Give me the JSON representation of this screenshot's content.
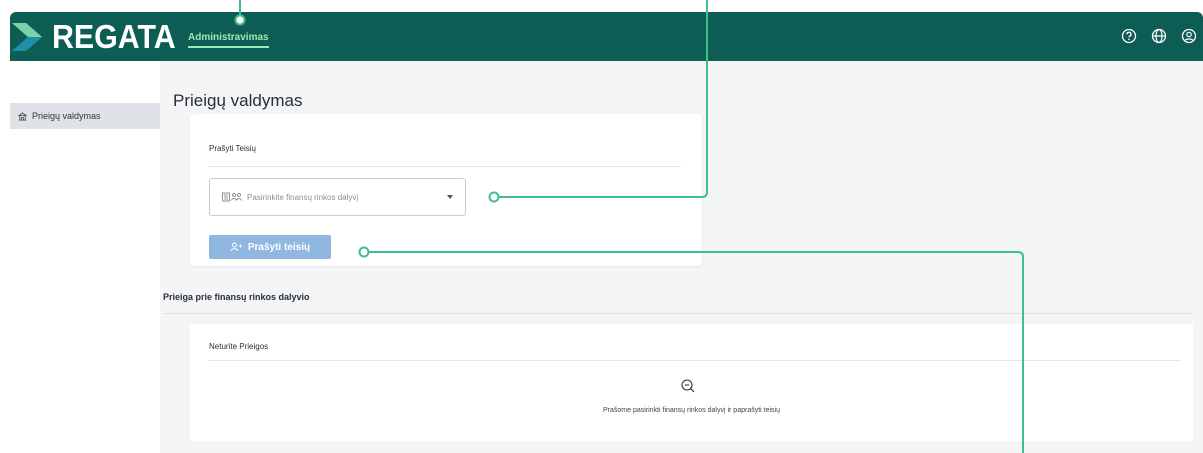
{
  "header": {
    "logo_text": "REGATA",
    "nav_link": "Administravimas",
    "icons": [
      "help-icon",
      "globe-icon",
      "user-icon"
    ]
  },
  "sidebar": {
    "items": [
      {
        "label": "Prieigų valdymas",
        "icon": "building-icon"
      }
    ]
  },
  "main": {
    "title": "Prieigų valdymas",
    "request_card": {
      "title": "Prašyti Teisių",
      "select_placeholder": "Pasirinkite finansų rinkos dalyvį",
      "button_label": "Prašyti teisių"
    },
    "access_section": {
      "title": "Prieiga prie finansų rinkos dalyvio",
      "card_title": "Neturite Prieigos",
      "empty_message": "Prašome pasirinkti finansų rinkos dalyvį ir paprašyti teisių"
    }
  },
  "colors": {
    "topbar": "#0e5d55",
    "accent": "#9fe6b5",
    "button": "#8fb7df",
    "callout": "#3fbf8c"
  }
}
